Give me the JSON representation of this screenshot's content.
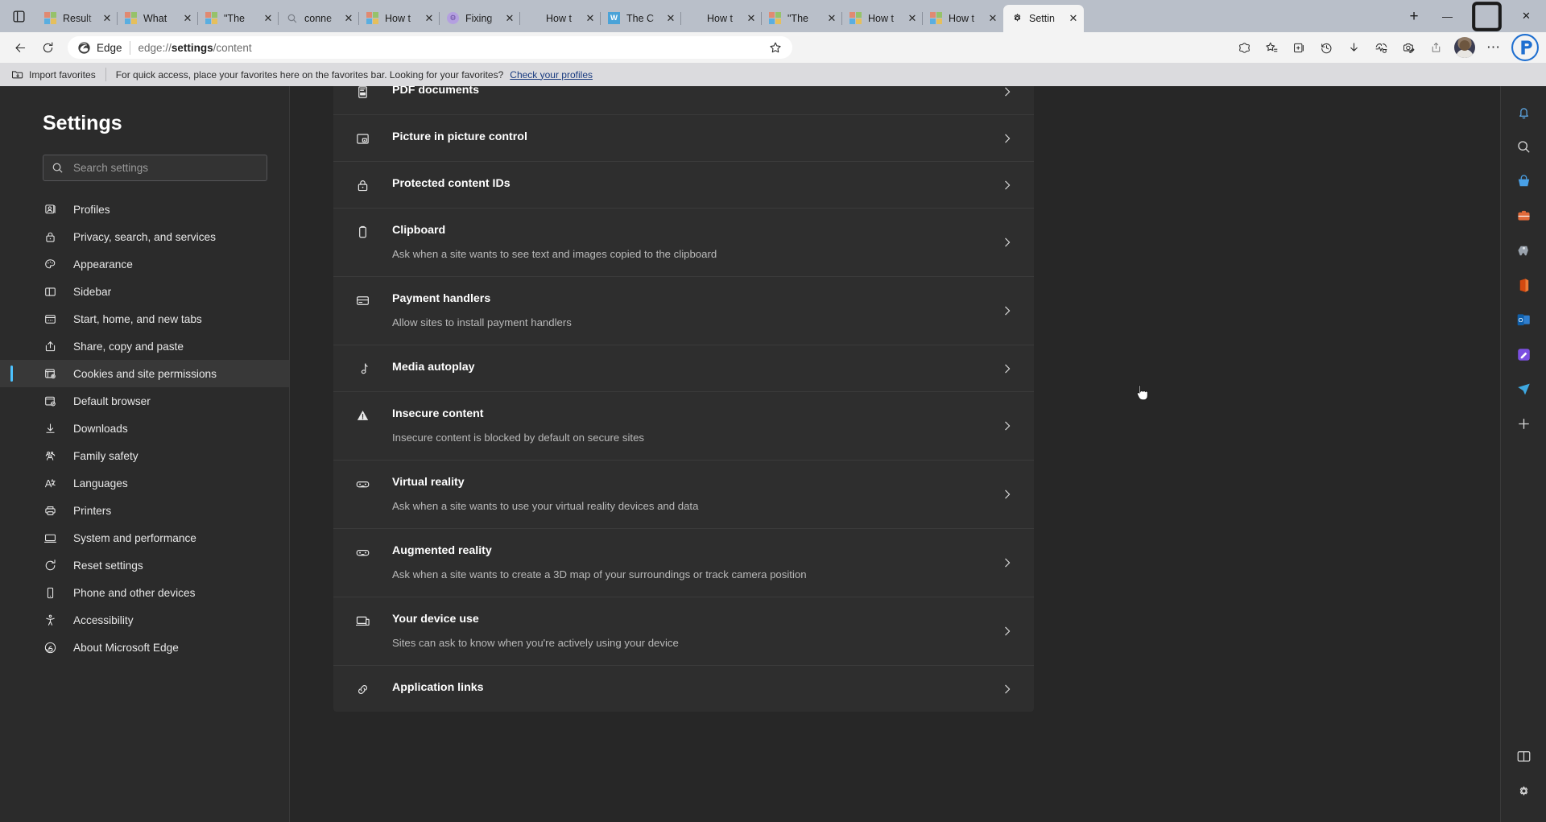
{
  "window": {
    "tab_menu_icon": "tab-actions-icon",
    "new_tab_label": "+",
    "minimize_label": "—",
    "maximize_label": "❐",
    "close_label": "✕",
    "close_tab_label": "✕"
  },
  "tabs": [
    {
      "title": "Result",
      "favicon": "microsoft-icon",
      "active": false
    },
    {
      "title": "What",
      "favicon": "microsoft-icon",
      "active": false
    },
    {
      "title": "\"The ",
      "favicon": "microsoft-icon",
      "active": false
    },
    {
      "title": "conne",
      "favicon": "search-icon",
      "active": false
    },
    {
      "title": "How t",
      "favicon": "microsoft-icon",
      "active": false
    },
    {
      "title": "Fixing",
      "favicon": "purple-node-icon",
      "active": false
    },
    {
      "title": "How t",
      "favicon": "teal-circle-icon",
      "active": false
    },
    {
      "title": "The C",
      "favicon": "word-icon",
      "active": false
    },
    {
      "title": "How t",
      "favicon": "teal-circle-icon",
      "active": false
    },
    {
      "title": "\"The ",
      "favicon": "microsoft-icon",
      "active": false
    },
    {
      "title": "How t",
      "favicon": "microsoft-icon",
      "active": false
    },
    {
      "title": "How t",
      "favicon": "microsoft-icon",
      "active": false
    },
    {
      "title": "Settin",
      "favicon": "gear-icon",
      "active": true
    }
  ],
  "toolbar": {
    "back_icon": "back-arrow-icon",
    "refresh_icon": "refresh-icon",
    "edge_label": "Edge",
    "url_prefix": "edge://",
    "url_bold": "settings",
    "url_suffix": "/content",
    "url_full": "edge://settings/content",
    "favorite_icon": "star-icon",
    "buttons": [
      {
        "name": "browser-essentials-icon"
      },
      {
        "name": "favorites-icon"
      },
      {
        "name": "collections-icon"
      },
      {
        "name": "history-icon"
      },
      {
        "name": "downloads-icon"
      },
      {
        "name": "performance-icon"
      },
      {
        "name": "screenshot-icon"
      },
      {
        "name": "share-icon"
      }
    ],
    "profile_name": "avatar",
    "more_label": "⋯",
    "copilot_icon": "copilot-icon"
  },
  "favorites_bar": {
    "import_label": "Import favorites",
    "import_icon": "folder-import-icon",
    "hint": "For quick access, place your favorites here on the favorites bar. Looking for your favorites?",
    "profiles_link": "Check your profiles"
  },
  "settings": {
    "title": "Settings",
    "search_placeholder": "Search settings",
    "search_value": "",
    "search_icon": "search-icon",
    "nav_items": [
      {
        "label": "Profiles",
        "icon": "profile-icon",
        "selected": false
      },
      {
        "label": "Privacy, search, and services",
        "icon": "lock-icon",
        "selected": false
      },
      {
        "label": "Appearance",
        "icon": "palette-icon",
        "selected": false
      },
      {
        "label": "Sidebar",
        "icon": "sidebar-icon",
        "selected": false
      },
      {
        "label": "Start, home, and new tabs",
        "icon": "start-home-icon",
        "selected": false
      },
      {
        "label": "Share, copy and paste",
        "icon": "share-icon",
        "selected": false
      },
      {
        "label": "Cookies and site permissions",
        "icon": "cookies-icon",
        "selected": true
      },
      {
        "label": "Default browser",
        "icon": "default-browser-icon",
        "selected": false
      },
      {
        "label": "Downloads",
        "icon": "download-icon",
        "selected": false
      },
      {
        "label": "Family safety",
        "icon": "family-icon",
        "selected": false
      },
      {
        "label": "Languages",
        "icon": "languages-icon",
        "selected": false
      },
      {
        "label": "Printers",
        "icon": "printer-icon",
        "selected": false
      },
      {
        "label": "System and performance",
        "icon": "system-icon",
        "selected": false
      },
      {
        "label": "Reset settings",
        "icon": "reset-icon",
        "selected": false
      },
      {
        "label": "Phone and other devices",
        "icon": "phone-icon",
        "selected": false
      },
      {
        "label": "Accessibility",
        "icon": "accessibility-icon",
        "selected": false
      },
      {
        "label": "About Microsoft Edge",
        "icon": "edge-icon",
        "selected": false
      }
    ]
  },
  "content_rows": [
    {
      "title": "PDF documents",
      "sub": "",
      "icon": "pdf-icon"
    },
    {
      "title": "Picture in picture control",
      "sub": "",
      "icon": "picture-in-picture-icon"
    },
    {
      "title": "Protected content IDs",
      "sub": "",
      "icon": "lock-icon"
    },
    {
      "title": "Clipboard",
      "sub": "Ask when a site wants to see text and images copied to the clipboard",
      "icon": "clipboard-icon"
    },
    {
      "title": "Payment handlers",
      "sub": "Allow sites to install payment handlers",
      "icon": "payment-icon"
    },
    {
      "title": "Media autoplay",
      "sub": "",
      "icon": "music-note-icon"
    },
    {
      "title": "Insecure content",
      "sub": "Insecure content is blocked by default on secure sites",
      "icon": "warning-icon"
    },
    {
      "title": "Virtual reality",
      "sub": "Ask when a site wants to use your virtual reality devices and data",
      "icon": "vr-headset-icon"
    },
    {
      "title": "Augmented reality",
      "sub": "Ask when a site wants to create a 3D map of your surroundings or track camera position",
      "icon": "ar-headset-icon"
    },
    {
      "title": "Your device use",
      "sub": "Sites can ask to know when you're actively using your device",
      "icon": "device-use-icon"
    },
    {
      "title": "Application links",
      "sub": "",
      "icon": "app-links-icon"
    }
  ],
  "row_chevron": "chevron-right-icon",
  "edge_rail": [
    {
      "icon": "notifications-icon"
    },
    {
      "icon": "search-icon"
    },
    {
      "icon": "shopping-icon"
    },
    {
      "icon": "tools-icon"
    },
    {
      "icon": "games-icon"
    },
    {
      "icon": "office-icon"
    },
    {
      "icon": "outlook-icon"
    },
    {
      "icon": "designer-icon"
    },
    {
      "icon": "drop-icon"
    },
    {
      "icon": "add-icon"
    }
  ],
  "edge_rail_bottom": [
    {
      "icon": "split-screen-icon"
    },
    {
      "icon": "settings-gear-icon"
    }
  ],
  "colors": {
    "accent": "#4cc2ff",
    "tabstrip": "#b9bfc9",
    "toolbar": "#f3f3f3",
    "favbar": "#dbdbde",
    "page_bg": "#272727",
    "card_bg": "#2e2e2e",
    "nav_bg": "#2b2b2b",
    "link": "#1a3c80"
  }
}
